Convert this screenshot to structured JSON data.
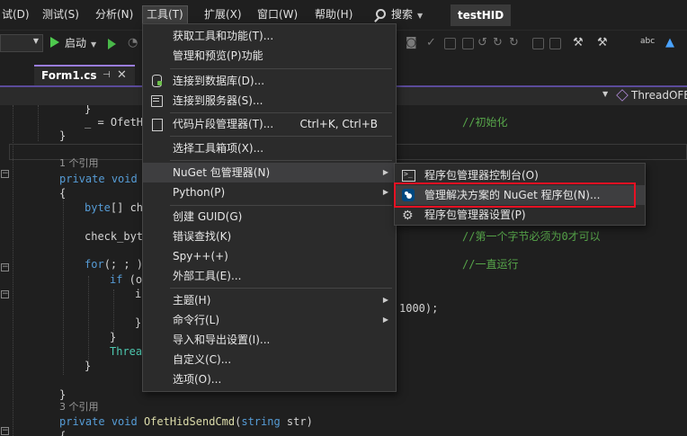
{
  "menubar": {
    "items": [
      "试(D)",
      "测试(S)",
      "分析(N)",
      "工具(T)",
      "扩展(X)",
      "窗口(W)",
      "帮助(H)"
    ],
    "search_label": "搜索",
    "project_name": "testHID"
  },
  "toolbar": {
    "start_label": "启动"
  },
  "tab": {
    "title": "Form1.cs",
    "pin_glyph": "⊣",
    "close_glyph": "✕"
  },
  "navbar": {
    "method": "ThreadOFE"
  },
  "code": {
    "l1_b": "}",
    "l2_pre": "_ = OfetHi",
    "l2_comment": "//初始化",
    "l3": "}",
    "ref1": "1 个引用",
    "l5_kw1": "private",
    "l5_kw2": "void",
    "l6": "{",
    "l7_kw": "byte",
    "l7_rest": "[] ch",
    "l8": "check_byt",
    "l8_comment": "//第一个字节必须为0才可以",
    "l9_kw": "for",
    "l9_rest": "(; ; )",
    "l9_comment": "//一直运行",
    "l10_kw": "if",
    "l10_rest": " (o",
    "l11": "i",
    "l12_rest": "1000);",
    "l13": "}",
    "l14": "}",
    "l15": "Threa",
    "l16": "}",
    "ref2": "3 个引用",
    "l18_kw1": "private",
    "l18_kw2": "void",
    "l18_fn": "OfetHidSendCmd",
    "l18_ty": "string",
    "l18_rest": " str)",
    "l19": "{",
    "l12_brace": "}"
  },
  "tools_menu": {
    "items": [
      {
        "label": "获取工具和功能(T)..."
      },
      {
        "label": "管理和预览(P)功能"
      },
      {
        "label": "连接到数据库(D)...",
        "icon": "database-icon"
      },
      {
        "label": "连接到服务器(S)...",
        "icon": "server-icon"
      },
      {
        "label": "代码片段管理器(T)...",
        "shortcut": "Ctrl+K, Ctrl+B",
        "icon": "snippet-icon"
      },
      {
        "label": "选择工具箱项(X)..."
      },
      {
        "label": "NuGet 包管理器(N)",
        "submenu": true
      },
      {
        "label": "Python(P)",
        "submenu": true
      },
      {
        "label": "创建 GUID(G)"
      },
      {
        "label": "错误查找(K)"
      },
      {
        "label": "Spy++(+)"
      },
      {
        "label": "外部工具(E)..."
      },
      {
        "label": "主题(H)",
        "submenu": true
      },
      {
        "label": "命令行(L)",
        "submenu": true
      },
      {
        "label": "导入和导出设置(I)..."
      },
      {
        "label": "自定义(C)..."
      },
      {
        "label": "选项(O)..."
      }
    ]
  },
  "nuget_menu": {
    "items": [
      {
        "label": "程序包管理器控制台(O)",
        "icon": "console-icon"
      },
      {
        "label": "管理解决方案的 NuGet 程序包(N)...",
        "icon": "nuget-icon"
      },
      {
        "label": "程序包管理器设置(P)",
        "icon": "settings-icon"
      }
    ]
  },
  "colors": {
    "highlight_box": "#e81123",
    "tab_accent": "#9a7de0",
    "menu_bg": "#2b2b2b"
  }
}
